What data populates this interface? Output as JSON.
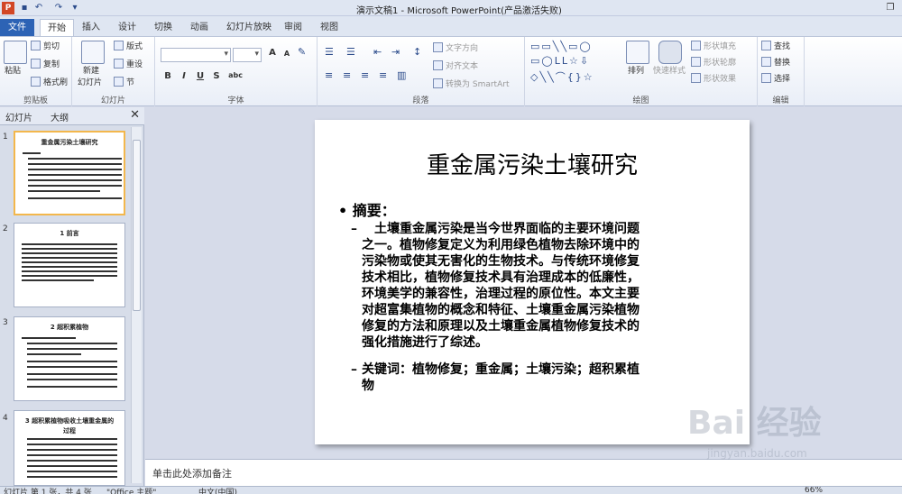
{
  "window": {
    "title": "演示文稿1 - Microsoft PowerPoint(产品激活失败)",
    "logo": "P"
  },
  "tabs": [
    "文件",
    "开始",
    "插入",
    "设计",
    "切换",
    "动画",
    "幻灯片放映",
    "审阅",
    "视图"
  ],
  "ribbon": {
    "clipboard": {
      "label": "剪贴板",
      "paste": "粘贴",
      "cut": "剪切",
      "copy": "复制",
      "format_painter": "格式刷"
    },
    "slides": {
      "label": "幻灯片",
      "new_slide": "新建",
      "new_slide_line2": "幻灯片",
      "layout": "版式",
      "reset": "重设",
      "section": "节"
    },
    "font": {
      "label": "字体",
      "bold": "B",
      "italic": "I",
      "underline": "U",
      "strike": "S",
      "shadow": "abc",
      "grow": "A",
      "shrink": "A"
    },
    "paragraph": {
      "label": "段落",
      "text_direction": "文字方向",
      "align_text": "对齐文本",
      "smartart": "转换为 SmartArt"
    },
    "drawing": {
      "label": "绘图",
      "arrange": "排列",
      "quick_styles": "快速样式",
      "shape_fill": "形状填充",
      "shape_outline": "形状轮廓",
      "shape_effects": "形状效果"
    },
    "editing": {
      "label": "编辑",
      "find": "查找",
      "replace": "替换",
      "select": "选择"
    }
  },
  "panel": {
    "tab_slides": "幻灯片",
    "tab_outline": "大纲",
    "thumbnails": [
      {
        "num": "1",
        "title": "重金属污染土壤研究"
      },
      {
        "num": "2",
        "title": "1 前言"
      },
      {
        "num": "3",
        "title": "2 超积累植物"
      },
      {
        "num": "4",
        "title": "3 超积累植物吸收土壤重金属的",
        "title2": "过程"
      }
    ]
  },
  "slide": {
    "title": "重金属污染土壤研究",
    "bullet": "• 摘要：",
    "sub1_lines": [
      "土壤重金属污染是当今世界面临的主要环境问题",
      "之一。植物修复定义为利用绿色植物去除环境中的",
      "污染物或使其无害化的生物技术。与传统环境修复",
      "技术相比，植物修复技术具有治理成本的低廉性，",
      "环境美学的兼容性，治理过程的原位性。本文主要",
      "对超富集植物的概念和特征、土壤重金属污染植物",
      "修复的方法和原理以及土壤重金属植物修复技术的",
      "强化措施进行了综述。"
    ],
    "sub2_lines": [
      "关键词：植物修复；重金属；土壤污染；超积累植",
      "物"
    ],
    "dash": "–"
  },
  "notes": {
    "placeholder": "单击此处添加备注"
  },
  "status": {
    "slide_info": "幻灯片 第 1 张，共 4 张",
    "theme": "\"Office 主题\"",
    "language": "中文(中国)",
    "zoom": "66%"
  },
  "watermark": {
    "logo": "Bai 经验",
    "url": "jingyan.baidu.com"
  }
}
